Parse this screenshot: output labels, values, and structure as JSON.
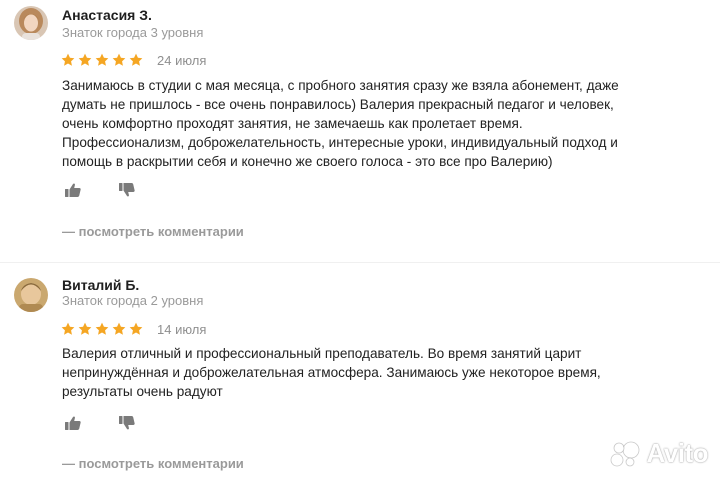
{
  "reviews": [
    {
      "author": "Анастасия З.",
      "level": "Знаток города 3 уровня",
      "avatar": "avatar-woman-photo",
      "rating": 5,
      "date": "24 июля",
      "text_lines": [
        "Занимаюсь в студии с мая месяца, с пробного занятия сразу же взяла абонемент, даже",
        "думать не пришлось - все очень понравилось) Валерия прекрасный педагог и человек,",
        "очень комфортно проходят занятия, не замечаешь как пролетает время.",
        "Профессионализм, доброжелательность, интересные уроки, индивидуальный подход и",
        "помощь в раскрытии себя и конечно же своего голоса - это все про Валерию)"
      ],
      "like_icon": "thumbs-up-icon",
      "dislike_icon": "thumbs-down-icon",
      "comments_link": "— посмотреть комментарии"
    },
    {
      "author": "Виталий Б.",
      "level": "Знаток города 2 уровня",
      "avatar": "avatar-man-photo",
      "rating": 5,
      "date": "14 июля",
      "text_lines": [
        "Валерия отличный и профессиональный преподаватель. Во время занятий царит",
        "непринуждённая и доброжелательная атмосфера. Занимаюсь уже некоторое время,",
        "результаты очень радуют"
      ],
      "like_icon": "thumbs-up-icon",
      "dislike_icon": "thumbs-down-icon",
      "comments_link": "— посмотреть комментарии"
    }
  ],
  "watermark": {
    "text": "Avito",
    "icon": "avito-logo-icon"
  },
  "colors": {
    "star": "#f5a623",
    "muted_text": "#9a9a9a",
    "icon_gray": "#7a7a7a"
  }
}
